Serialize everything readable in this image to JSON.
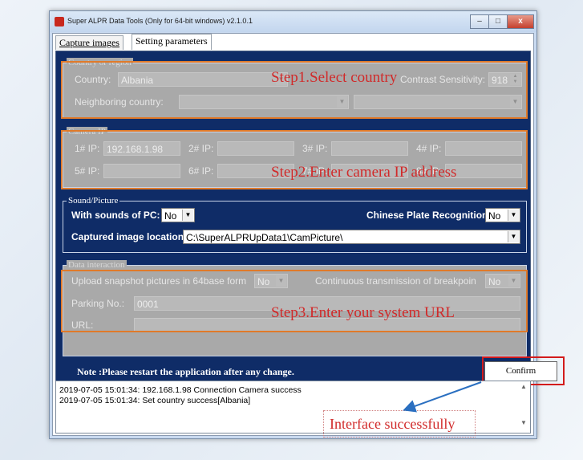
{
  "window": {
    "title": "Super ALPR Data Tools (Only for 64-bit windows)    v2.1.0.1",
    "min": "–",
    "max": "□",
    "close": "x"
  },
  "tabs": [
    {
      "label": "Capture images"
    },
    {
      "label": "Setting parameters"
    }
  ],
  "country_group": {
    "legend": "Country or region",
    "country_label": "Country:",
    "country_value": "Albania",
    "sensitivity_label": "Contrast Sensitivity:",
    "sensitivity_value": "918",
    "neighbor_label": "Neighboring country:",
    "neighbor_value1": "",
    "neighbor_value2": ""
  },
  "camera_group": {
    "legend": "Camera IP",
    "ip_labels": [
      "1# IP:",
      "2# IP:",
      "3# IP:",
      "4# IP:",
      "5# IP:",
      "6# IP:",
      "7# IP:",
      "8# IP:"
    ],
    "ip_values": [
      "192.168.1.98",
      "",
      "",
      "",
      "",
      "",
      "",
      ""
    ]
  },
  "sound_group": {
    "legend": "Sound/Picture",
    "sounds_label": "With sounds of  PC:",
    "sounds_value": "No",
    "chinese_label": "Chinese Plate Recognition",
    "chinese_value": "No",
    "location_label": "Captured image location",
    "location_value": "C:\\SuperALPRUpData1\\CamPicture\\"
  },
  "data_group": {
    "legend": "Data interaction",
    "upload_label": "Upload snapshot pictures in 64base form",
    "upload_value": "No",
    "continuous_label": "Continuous transmission of breakpoin",
    "continuous_value": "No",
    "parking_label": "Parking No.:",
    "parking_value": "0001",
    "url_label": "URL:",
    "url_value": ""
  },
  "annotations": {
    "step1": "Step1.Select country",
    "step2": "Step2.Enter camera IP address",
    "step3": "Step3.Enter your system URL",
    "interface": "Interface successfully"
  },
  "note": "Note :Please restart the application after any change.",
  "confirm_label": "Confirm",
  "log": [
    "2019-07-05 15:01:34: 192.168.1.98 Connection Camera success",
    "2019-07-05 15:01:34: Set country success[Albania]"
  ],
  "colors": {
    "panel_navy": "#0f2c67",
    "disabled_gray": "#a9a9a9",
    "annotation_red": "#d12a2a",
    "highlight_orange": "#e07a2a",
    "arrow_blue": "#2a6fc0"
  }
}
